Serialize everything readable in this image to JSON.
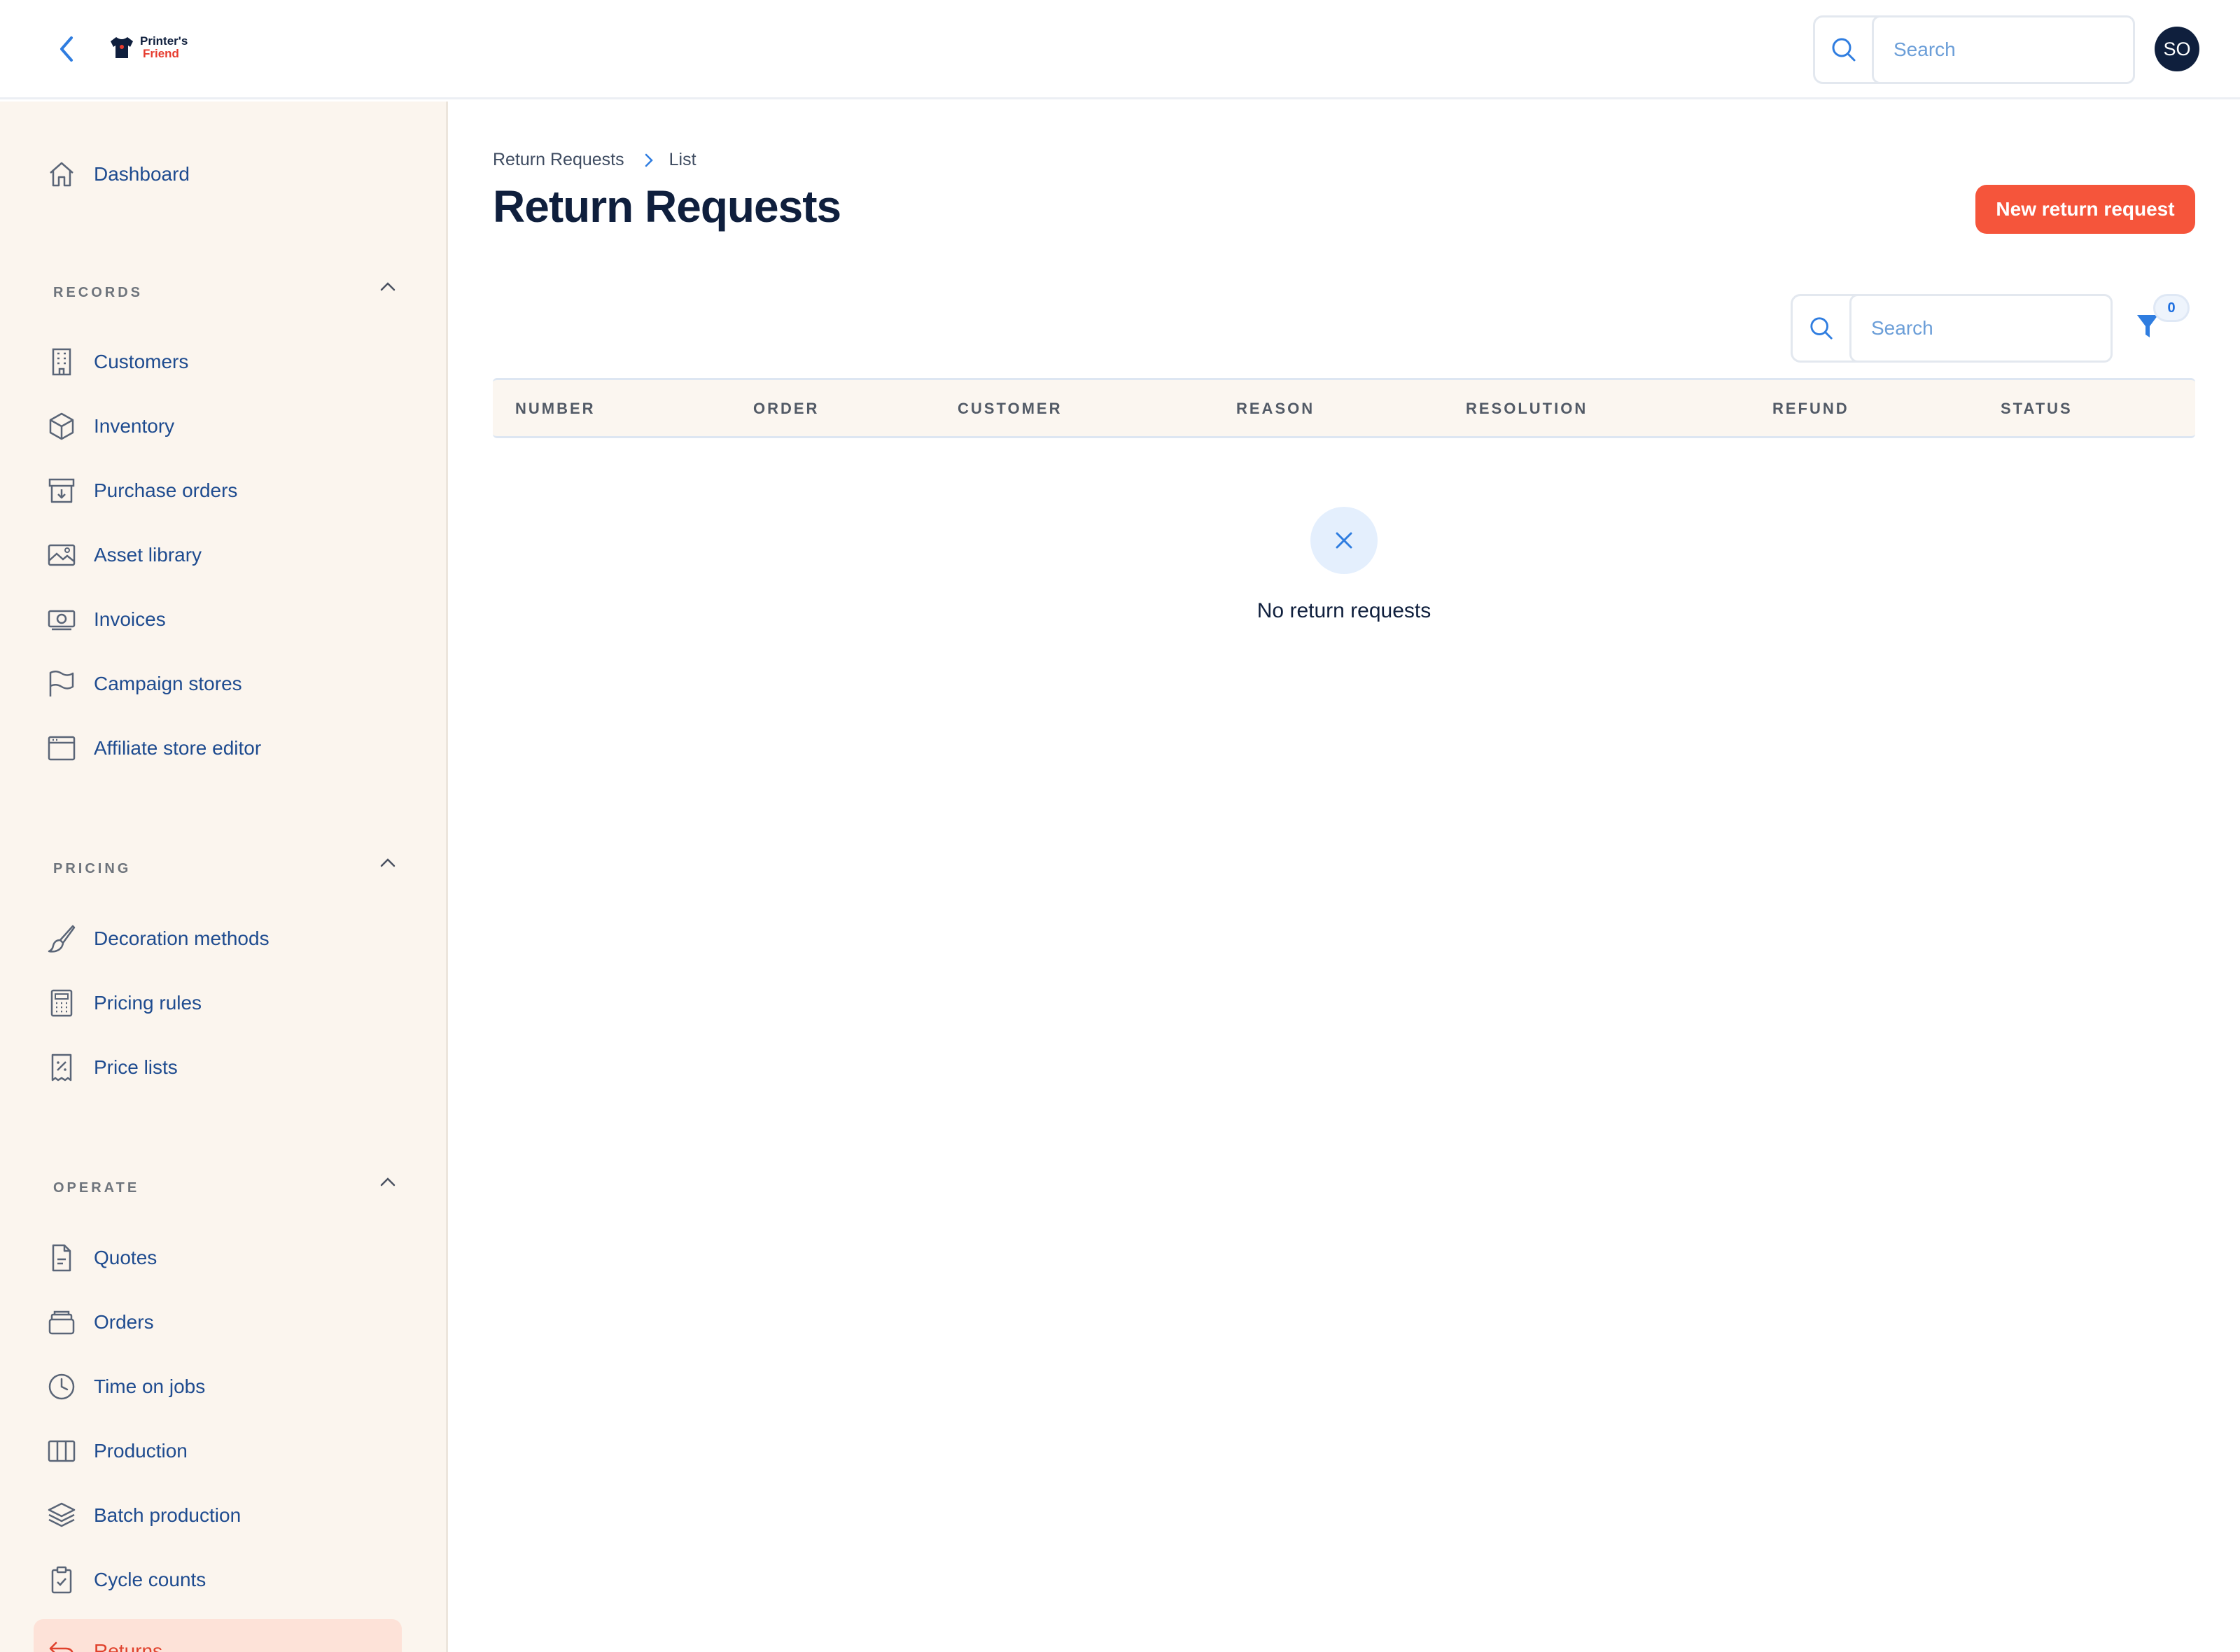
{
  "header": {
    "logo_line1": "Printer's",
    "logo_line2": "Friend",
    "search_placeholder": "Search",
    "avatar_initials": "SO"
  },
  "sidebar": {
    "dashboard": "Dashboard",
    "sections": {
      "records": {
        "title": "RECORDS",
        "items": [
          "Customers",
          "Inventory",
          "Purchase orders",
          "Asset library",
          "Invoices",
          "Campaign stores",
          "Affiliate store editor"
        ]
      },
      "pricing": {
        "title": "PRICING",
        "items": [
          "Decoration methods",
          "Pricing rules",
          "Price lists"
        ]
      },
      "operate": {
        "title": "OPERATE",
        "items": [
          "Quotes",
          "Orders",
          "Time on jobs",
          "Production",
          "Batch production",
          "Cycle counts",
          "Returns"
        ]
      }
    },
    "active_item": "Returns"
  },
  "main": {
    "breadcrumb": [
      "Return Requests",
      "List"
    ],
    "title": "Return Requests",
    "new_button": "New return request",
    "search_placeholder": "Search",
    "filter_count": "0",
    "columns": [
      "NUMBER",
      "ORDER",
      "CUSTOMER",
      "REASON",
      "RESOLUTION",
      "REFUND",
      "STATUS"
    ],
    "empty_message": "No return requests"
  },
  "colors": {
    "accent": "#f5553b",
    "navy": "#0f1f3d",
    "link": "#1e4b8f",
    "sidebar_bg": "#fbf5ee",
    "active_bg": "#fde2d8"
  }
}
